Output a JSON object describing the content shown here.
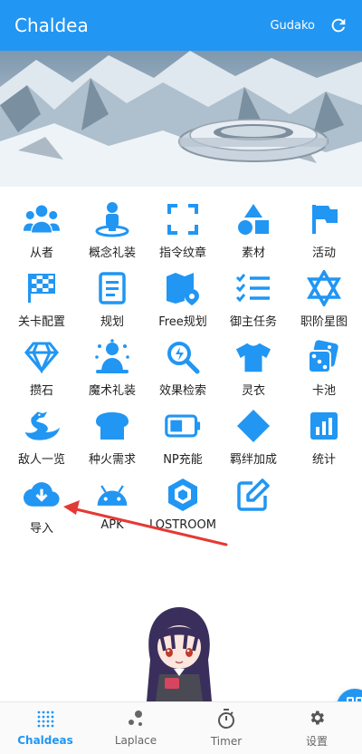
{
  "app_bar": {
    "title": "Chaldea",
    "account": "Gudako"
  },
  "banner": {
    "alt": "Chaldea"
  },
  "grid": [
    {
      "label": "从者",
      "icon": "servants-icon"
    },
    {
      "label": "概念礼装",
      "icon": "craft-essence-icon"
    },
    {
      "label": "指令纹章",
      "icon": "command-code-icon"
    },
    {
      "label": "素材",
      "icon": "materials-icon"
    },
    {
      "label": "活动",
      "icon": "events-flag-icon"
    },
    {
      "label": "关卡配置",
      "icon": "quest-checkered-flag-icon"
    },
    {
      "label": "规划",
      "icon": "plan-icon"
    },
    {
      "label": "Free规划",
      "icon": "map-pin-icon"
    },
    {
      "label": "御主任务",
      "icon": "task-list-icon"
    },
    {
      "label": "职阶星图",
      "icon": "star-of-david-icon"
    },
    {
      "label": "攒石",
      "icon": "diamond-icon"
    },
    {
      "label": "魔术礼装",
      "icon": "mystic-code-icon"
    },
    {
      "label": "效果检索",
      "icon": "search-effect-icon"
    },
    {
      "label": "灵衣",
      "icon": "costume-shirt-icon"
    },
    {
      "label": "卡池",
      "icon": "dice-icon"
    },
    {
      "label": "敌人一览",
      "icon": "dragon-icon"
    },
    {
      "label": "种火需求",
      "icon": "bread-icon"
    },
    {
      "label": "NP充能",
      "icon": "battery-icon"
    },
    {
      "label": "羁绊加成",
      "icon": "rhombus-icon"
    },
    {
      "label": "统计",
      "icon": "bar-chart-icon"
    },
    {
      "label": "导入",
      "icon": "cloud-download-icon"
    },
    {
      "label": "APK",
      "icon": "android-icon"
    },
    {
      "label": "LOSTROOM",
      "icon": "unity-cube-icon"
    },
    {
      "label": "",
      "icon": "edit-icon"
    }
  ],
  "bottom_nav": [
    {
      "label": "Chaldeas",
      "icon": "grid-dots-icon",
      "active": true
    },
    {
      "label": "Laplace",
      "icon": "bubbles-icon",
      "active": false
    },
    {
      "label": "Timer",
      "icon": "stopwatch-icon",
      "active": false
    },
    {
      "label": "设置",
      "icon": "gear-icon",
      "active": false
    }
  ],
  "colors": {
    "primary": "#2196f3",
    "annotation_arrow": "#e53935"
  }
}
